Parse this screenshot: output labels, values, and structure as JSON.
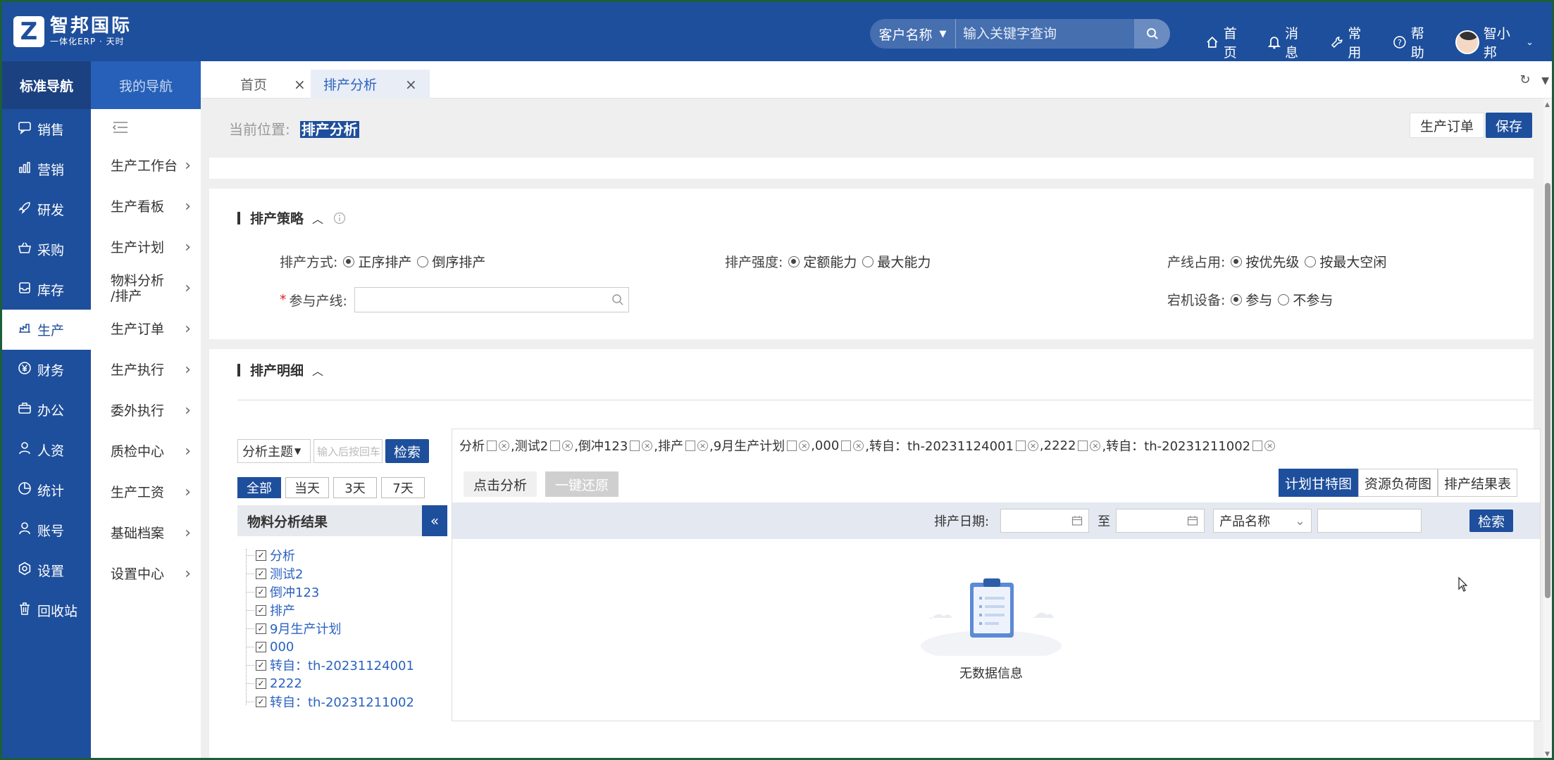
{
  "app": {
    "logo_letter": "Z",
    "logo_name": "智邦国际",
    "logo_sub": "一体化ERP · 天时"
  },
  "search": {
    "category": "客户名称",
    "placeholder": "输入关键字查询"
  },
  "topnav": {
    "home": "首页",
    "messages": "消息",
    "common": "常用",
    "help": "帮助",
    "user": "智小邦"
  },
  "nav1": {
    "header": "标准导航",
    "items": [
      {
        "label": "销售",
        "icon": "chat-icon"
      },
      {
        "label": "营销",
        "icon": "bar-chart-icon"
      },
      {
        "label": "研发",
        "icon": "rocket-icon"
      },
      {
        "label": "采购",
        "icon": "basket-icon"
      },
      {
        "label": "库存",
        "icon": "inventory-icon"
      },
      {
        "label": "生产",
        "icon": "production-icon"
      },
      {
        "label": "财务",
        "icon": "yen-icon"
      },
      {
        "label": "办公",
        "icon": "briefcase-icon"
      },
      {
        "label": "人资",
        "icon": "person-icon"
      },
      {
        "label": "统计",
        "icon": "pie-icon"
      },
      {
        "label": "账号",
        "icon": "user-icon"
      },
      {
        "label": "设置",
        "icon": "settings-icon"
      },
      {
        "label": "回收站",
        "icon": "trash-icon"
      }
    ],
    "active_index": 5
  },
  "nav2": {
    "header": "我的导航",
    "items": [
      {
        "label": "生产工作台"
      },
      {
        "label": "生产看板"
      },
      {
        "label": "生产计划"
      },
      {
        "label": "物料分析\n/排产"
      },
      {
        "label": "生产订单"
      },
      {
        "label": "生产执行"
      },
      {
        "label": "委外执行"
      },
      {
        "label": "质检中心"
      },
      {
        "label": "生产工资"
      },
      {
        "label": "基础档案"
      },
      {
        "label": "设置中心"
      }
    ]
  },
  "tabs": {
    "home": "首页",
    "active": "排产分析"
  },
  "page": {
    "crumb_label": "当前位置:",
    "crumb_current": "排产分析",
    "order_button": "生产订单",
    "save_button": "保存"
  },
  "strategy": {
    "title": "排产策略",
    "mode_label": "排产方式:",
    "mode_options": [
      "正序排产",
      "倒序排产"
    ],
    "mode_selected": 0,
    "intensity_label": "排产强度:",
    "intensity_options": [
      "定额能力",
      "最大能力"
    ],
    "intensity_selected": 0,
    "line_label": "产线占用:",
    "line_options": [
      "按优先级",
      "按最大空闲"
    ],
    "line_selected": 0,
    "participate_label": "参与产线:",
    "participate_value": "",
    "downtime_label": "宕机设备:",
    "downtime_options": [
      "参与",
      "不参与"
    ],
    "downtime_selected": 0
  },
  "detail": {
    "title": "排产明细",
    "theme_select": "分析主题",
    "keyword_placeholder": "输入后按回车",
    "search_button": "检索",
    "ranges": [
      "全部",
      "当天",
      "3天",
      "7天"
    ],
    "range_selected": 0,
    "tree_title": "物料分析结果",
    "tree_items": [
      "分析",
      "测试2",
      "倒冲123",
      "排产",
      "9月生产计划",
      "000",
      "转自：th-20231124001",
      "2222",
      "转自：th-20231211002"
    ],
    "tags": [
      "分析",
      ",测试2",
      ",倒冲123",
      ",排产",
      ",9月生产计划",
      ",000",
      ",转自：th-20231124001",
      ",2222",
      ",转自：th-20231211002"
    ],
    "analyze_button": "点击分析",
    "restore_button": "一键还原",
    "views": [
      "计划甘特图",
      "资源负荷图",
      "排产结果表"
    ],
    "view_selected": 0,
    "date_label": "排产日期:",
    "to_label": "至",
    "product_select": "产品名称",
    "query_button": "检索",
    "empty_text": "无数据信息"
  }
}
